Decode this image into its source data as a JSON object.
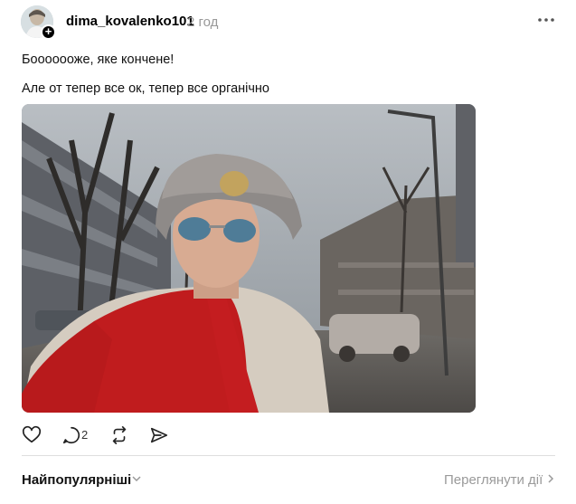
{
  "post": {
    "username": "dima_kovalenko101",
    "time": "2 год",
    "lines": [
      "Бооооооже, яке кончене!",
      "Але от тепер все ок, тепер все органічно"
    ],
    "photo_icon": "selfie-photo",
    "more_icon": "more-horizontal-icon"
  },
  "actions": {
    "like_icon": "heart-icon",
    "comment_icon": "comment-icon",
    "comment_count": "2",
    "repost_icon": "repost-icon",
    "share_icon": "send-icon"
  },
  "footer": {
    "sort_label": "Найпопулярніші",
    "view_label": "Переглянути дії"
  },
  "colors": {
    "text": "#000000",
    "muted": "#999999",
    "divider": "#dedede"
  }
}
